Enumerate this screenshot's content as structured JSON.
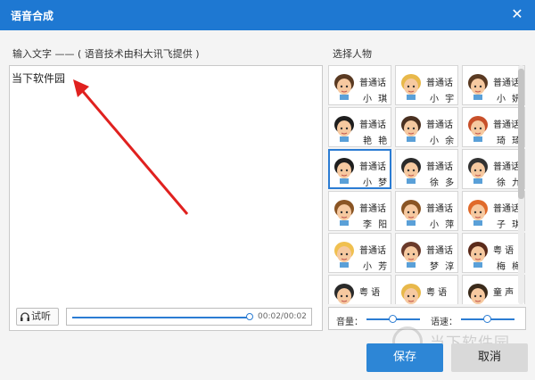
{
  "window": {
    "title": "语音合成",
    "close_symbol": "✕"
  },
  "input": {
    "label": "输入文字 —— ( 语音技术由科大讯飞提供 )",
    "text": "当下软件园"
  },
  "player": {
    "listen_label": "试听",
    "progress": 1.0,
    "time": "00:02/00:02"
  },
  "voices": {
    "label": "选择人物",
    "items": [
      {
        "lang": "普通话",
        "name": "小 琪",
        "face": "girl-pigtails-icon",
        "selected": false
      },
      {
        "lang": "普通话",
        "name": "小 宇",
        "face": "boy-blond-icon",
        "selected": false
      },
      {
        "lang": "普通话",
        "name": "小 妍",
        "face": "woman-hairband-icon",
        "selected": false
      },
      {
        "lang": "普通话",
        "name": "艳 艳",
        "face": "girl-black-hair-icon",
        "selected": false
      },
      {
        "lang": "普通话",
        "name": "小 余",
        "face": "man-brown-hair-icon",
        "selected": false
      },
      {
        "lang": "普通话",
        "name": "琦 琦",
        "face": "girl-red-hair-icon",
        "selected": false
      },
      {
        "lang": "普通话",
        "name": "小 梦",
        "face": "girl-black-long-hair-icon",
        "selected": true
      },
      {
        "lang": "普通话",
        "name": "徐 多",
        "face": "man-mustache-icon",
        "selected": false
      },
      {
        "lang": "普通话",
        "name": "徐 九",
        "face": "boy-cap-icon",
        "selected": false
      },
      {
        "lang": "普通话",
        "name": "李 阳",
        "face": "boy-brown-hair-icon",
        "selected": false
      },
      {
        "lang": "普通话",
        "name": "小 萍",
        "face": "girl-glasses-icon",
        "selected": false
      },
      {
        "lang": "普通话",
        "name": "子 琪",
        "face": "girl-orange-hair-icon",
        "selected": false
      },
      {
        "lang": "普通话",
        "name": "小 芳",
        "face": "girl-blonde-icon",
        "selected": false
      },
      {
        "lang": "普通话",
        "name": "梦 淳",
        "face": "woman-long-hair-icon",
        "selected": false
      },
      {
        "lang": "粤 语",
        "name": "梅 梅",
        "face": "woman-headband-icon",
        "selected": false
      },
      {
        "lang": "粤 语",
        "name": "",
        "face": "boy-dark-hair-icon",
        "selected": false
      },
      {
        "lang": "粤 语",
        "name": "",
        "face": "girl-blond-icon",
        "selected": false
      },
      {
        "lang": "童 声",
        "name": "",
        "face": "boy-child-icon",
        "selected": false
      }
    ]
  },
  "sliders": {
    "volume_label": "音量：",
    "volume": 0.5,
    "speed_label": "语速：",
    "speed": 0.5
  },
  "buttons": {
    "save": "保存",
    "cancel": "取消"
  },
  "watermark": {
    "text": "当下软件园"
  },
  "colors": {
    "titlebar": "#1e78d2",
    "accent": "#2b7cd3",
    "arrow": "#e0211f"
  }
}
